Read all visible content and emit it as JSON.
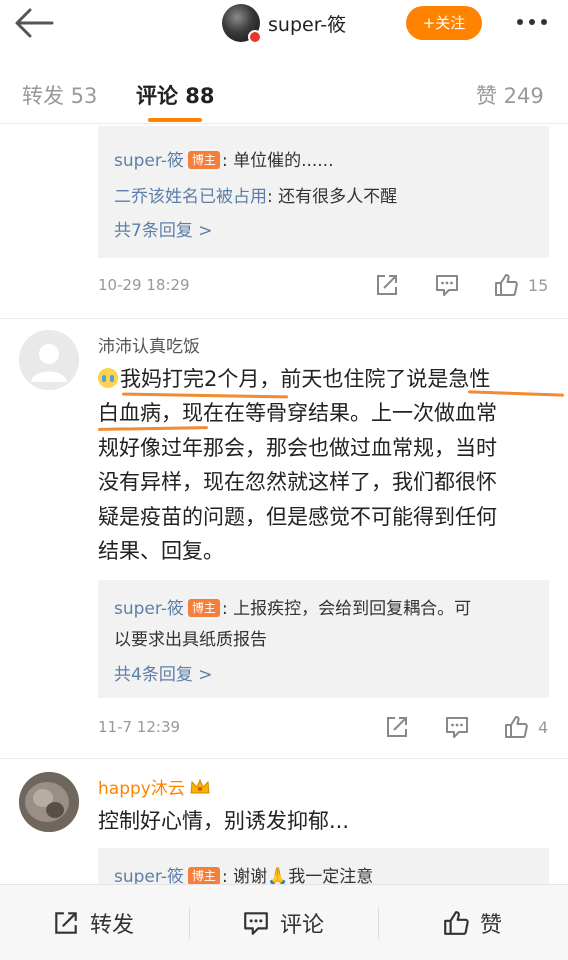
{
  "header": {
    "user_name": "super-筱",
    "follow_label": "+关注"
  },
  "tabs": [
    {
      "label": "转发 53"
    },
    {
      "label": "评论 88"
    },
    {
      "label": "赞 249"
    }
  ],
  "comments": [
    {
      "replies": [
        {
          "user": "super-筱",
          "tag": "博主",
          "text": ": 单位催的......"
        },
        {
          "user": "二乔该姓名已被占用",
          "text": ": 还有很多人不醒"
        }
      ],
      "more_replies": "共7条回复 >",
      "timestamp": "10-29 18:29",
      "likes": "15"
    },
    {
      "user": "沛沛认真吃饭",
      "text_lines": [
        "我妈打完2个月，前天也住院了说是急性",
        "白血病，现在在等骨穿结果。上一次做血常",
        "规好像过年那会，那会也做过血常规，当时",
        "没有异样，现在忽然就这样了，我们都很怀",
        "疑是疫苗的问题，但是感觉不可能得到任何",
        "结果、回复。"
      ],
      "replies": [
        {
          "user": "super-筱",
          "tag": "博主",
          "text": ": 上报疾控，会给到回复耦合。可"
        },
        {
          "text": "以要求出具纸质报告"
        }
      ],
      "more_replies": "共4条回复 >",
      "timestamp": "11-7 12:39",
      "likes": "4"
    },
    {
      "user": "happy沐云",
      "text": "控制好心情，别诱发抑郁...",
      "replies": [
        {
          "user": "super-筱",
          "tag": "博主",
          "text": ": 谢谢🙏我一定注意"
        }
      ]
    }
  ],
  "bottom_bar": {
    "repost_label": "转发",
    "comment_label": "评论",
    "like_label": "赞"
  },
  "colors": {
    "accent": "#ff8200",
    "link": "#5d7ea8",
    "tag": "#f37f3a",
    "reply_bg": "#f2f2f2"
  },
  "icons": [
    "back-arrow-icon",
    "more-dots-icon",
    "share-icon",
    "comment-icon",
    "thumbs-up-icon",
    "cry-emoji-icon",
    "crown-emoji-icon",
    "chevron-right-icon"
  ]
}
